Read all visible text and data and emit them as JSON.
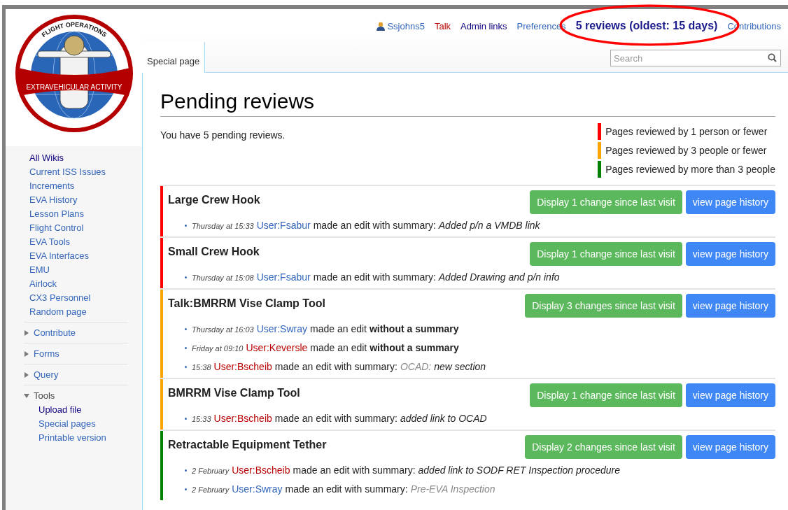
{
  "logo": {
    "arc_text": "FLIGHT OPERATIONS",
    "banner_text": "EXTRAVEHICULAR ACTIVITY"
  },
  "sidebar": {
    "links": [
      {
        "label": "All Wikis",
        "visited": true
      },
      {
        "label": "Current ISS Issues",
        "visited": false
      },
      {
        "label": "Increments",
        "visited": false
      },
      {
        "label": "EVA History",
        "visited": false
      },
      {
        "label": "Lesson Plans",
        "visited": false
      },
      {
        "label": "Flight Control",
        "visited": false
      },
      {
        "label": "EVA Tools",
        "visited": false
      },
      {
        "label": "EVA Interfaces",
        "visited": false
      },
      {
        "label": "EMU",
        "visited": false
      },
      {
        "label": "Airlock",
        "visited": false
      },
      {
        "label": "CX3 Personnel",
        "visited": false
      },
      {
        "label": "Random page",
        "visited": false
      }
    ],
    "sections": [
      {
        "label": "Contribute",
        "expanded": false
      },
      {
        "label": "Forms",
        "expanded": false
      },
      {
        "label": "Query",
        "expanded": false
      },
      {
        "label": "Tools",
        "expanded": true,
        "children": [
          {
            "label": "Upload file",
            "visited": true
          },
          {
            "label": "Special pages",
            "visited": false
          },
          {
            "label": "Printable version",
            "visited": false
          }
        ]
      }
    ]
  },
  "personal_tools": [
    {
      "label": "Ssjohns5",
      "missing": false,
      "visited": false,
      "kind": "user",
      "circled": false
    },
    {
      "label": "Talk",
      "missing": true,
      "visited": false,
      "kind": "link",
      "circled": false
    },
    {
      "label": "Admin links",
      "missing": false,
      "visited": true,
      "kind": "link",
      "circled": false
    },
    {
      "label": "Preferences",
      "missing": false,
      "visited": false,
      "kind": "link",
      "circled": false
    },
    {
      "label": "5 reviews (oldest: 15 days)",
      "missing": false,
      "visited": false,
      "kind": "reviews",
      "circled": true
    },
    {
      "label": "Contributions",
      "missing": false,
      "visited": false,
      "kind": "link",
      "circled": false
    }
  ],
  "tabs": [
    {
      "label": "Special page",
      "selected": true
    }
  ],
  "search": {
    "placeholder": "Search"
  },
  "page": {
    "title": "Pending reviews",
    "intro": "You have 5 pending reviews."
  },
  "legend": [
    {
      "label": "Pages reviewed by 1 person or fewer",
      "color": "#ff0000"
    },
    {
      "label": "Pages reviewed by 3 people or fewer",
      "color": "#ffa500"
    },
    {
      "label": "Pages reviewed by more than 3 people",
      "color": "#008000"
    }
  ],
  "reviews": [
    {
      "title": "Large Crew Hook",
      "color": "#ff0000",
      "changes_button": "Display 1 change since last visit",
      "history_button": "view page history",
      "edits": [
        {
          "time": "Thursday at 15:33",
          "user": "User:Fsabur",
          "missing": false,
          "action": "made an edit with summary:",
          "summary": "Added p/n a VMDB link"
        }
      ]
    },
    {
      "title": "Small Crew Hook",
      "color": "#ff0000",
      "changes_button": "Display 1 change since last visit",
      "history_button": "view page history",
      "edits": [
        {
          "time": "Thursday at 15:08",
          "user": "User:Fsabur",
          "missing": false,
          "action": "made an edit with summary:",
          "summary": "Added Drawing and p/n info"
        }
      ]
    },
    {
      "title": "Talk:BMRRM Vise Clamp Tool",
      "color": "#ffa500",
      "changes_button": "Display 3 changes since last visit",
      "history_button": "view page history",
      "edits": [
        {
          "time": "Thursday at 16:03",
          "user": "User:Swray",
          "missing": false,
          "action": "made an edit **without a summary**"
        },
        {
          "time": "Friday at 09:10",
          "user": "User:Keversle",
          "missing": true,
          "action": "made an edit **without a summary**"
        },
        {
          "time": "15:38",
          "user": "User:Bscheib",
          "missing": true,
          "action": "made an edit with summary:",
          "section": "OCAD:",
          "summary": "new section"
        }
      ]
    },
    {
      "title": "BMRRM Vise Clamp Tool",
      "color": "#ffa500",
      "changes_button": "Display 1 change since last visit",
      "history_button": "view page history",
      "edits": [
        {
          "time": "15:33",
          "user": "User:Bscheib",
          "missing": true,
          "action": "made an edit with summary:",
          "summary": "added link to OCAD"
        }
      ]
    },
    {
      "title": "Retractable Equipment Tether",
      "color": "#008000",
      "changes_button": "Display 2 changes since last visit",
      "history_button": "view page history",
      "edits": [
        {
          "time": "2 February",
          "user": "User:Bscheib",
          "missing": true,
          "action": "made an edit with summary:",
          "summary": "added link to SODF RET Inspection procedure"
        },
        {
          "time": "2 February",
          "user": "User:Swray",
          "missing": false,
          "action": "made an edit with summary:",
          "section": "Pre-EVA Inspection"
        }
      ]
    }
  ]
}
